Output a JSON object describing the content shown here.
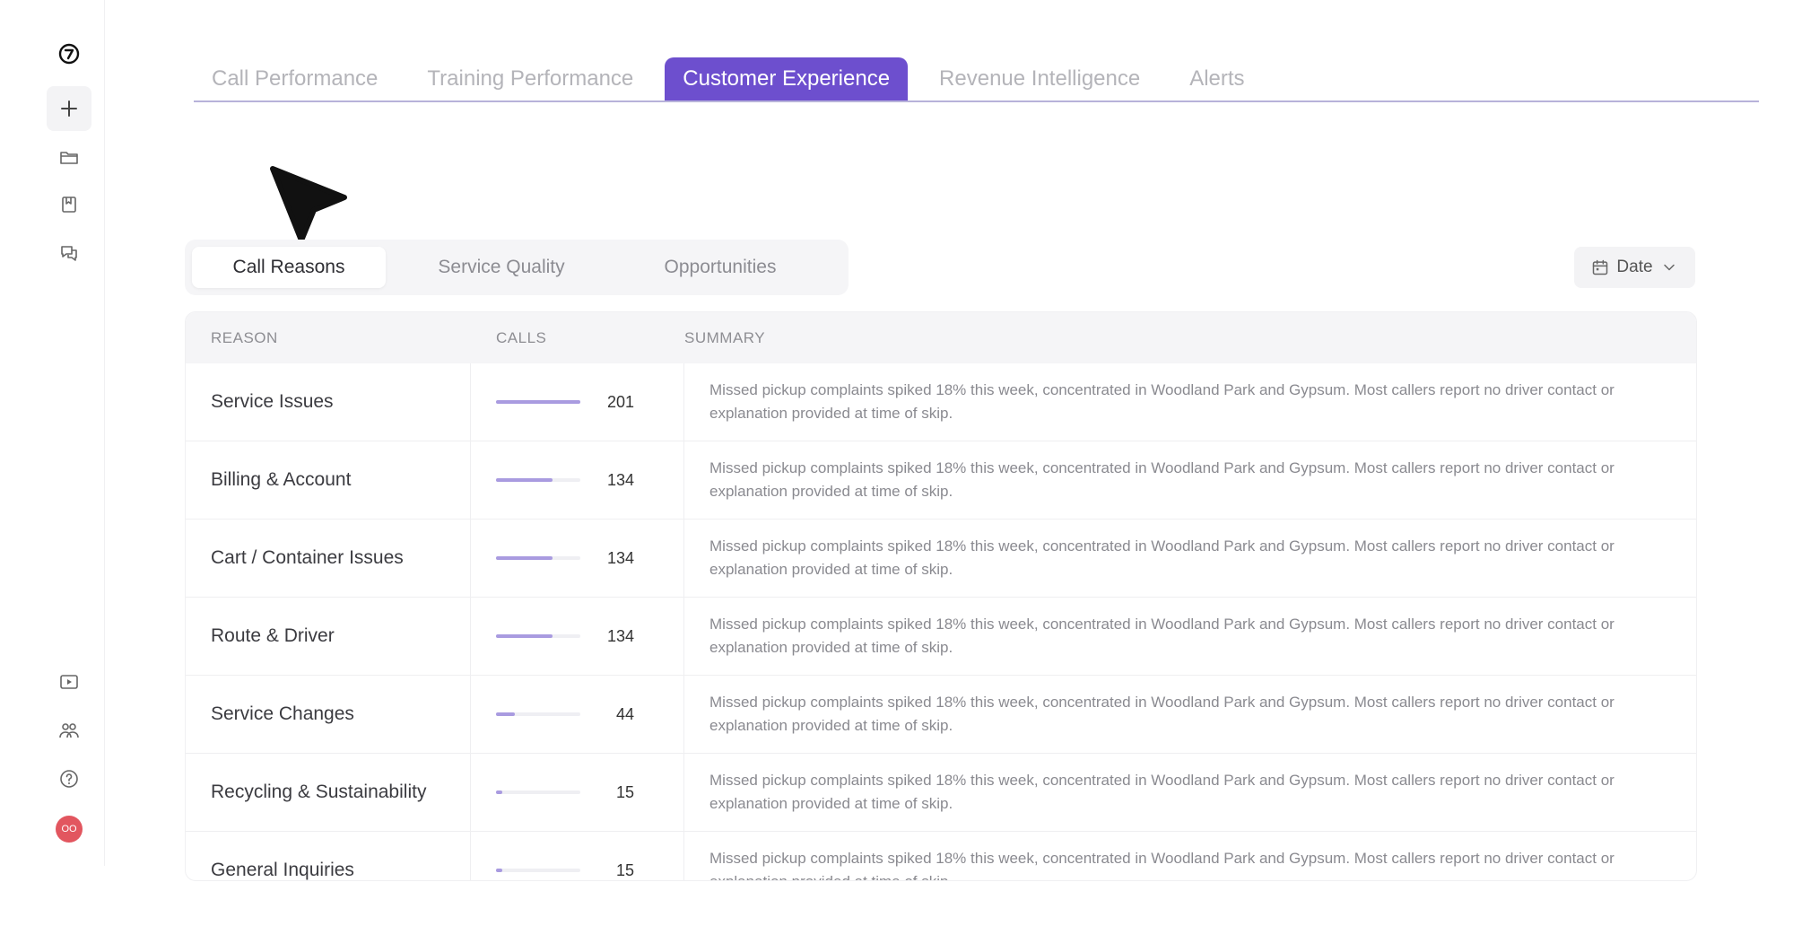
{
  "sidebar": {
    "top_icons": [
      "logo-icon",
      "plus-icon",
      "folder-icon",
      "bookmark-icon",
      "chat-icon"
    ],
    "bottom_icons": [
      "video-icon",
      "team-icon",
      "help-icon"
    ],
    "avatar": "OO"
  },
  "top_tabs": [
    {
      "label": "Call Performance",
      "active": false
    },
    {
      "label": "Training Performance",
      "active": false
    },
    {
      "label": "Customer Experience",
      "active": true
    },
    {
      "label": "Revenue Intelligence",
      "active": false
    },
    {
      "label": "Alerts",
      "active": false
    }
  ],
  "sub_tabs": [
    {
      "label": "Call Reasons",
      "active": true
    },
    {
      "label": "Service Quality",
      "active": false
    },
    {
      "label": "Opportunities",
      "active": false
    }
  ],
  "date_filter": {
    "label": "Date"
  },
  "table": {
    "headers": {
      "reason": "REASON",
      "calls": "CALLS",
      "summary": "SUMMARY"
    },
    "rows": [
      {
        "reason": "Service Issues",
        "calls": "201",
        "fraction": 1.0,
        "summary": "Missed pickup complaints spiked 18% this week, concentrated in Woodland Park and Gypsum. Most callers report no driver contact or explanation provided at time of skip."
      },
      {
        "reason": "Billing & Account",
        "calls": "134",
        "fraction": 0.667,
        "summary": "Missed pickup complaints spiked 18% this week, concentrated in Woodland Park and Gypsum. Most callers report no driver contact or explanation provided at time of skip."
      },
      {
        "reason": "Cart / Container Issues",
        "calls": "134",
        "fraction": 0.667,
        "summary": "Missed pickup complaints spiked 18% this week, concentrated in Woodland Park and Gypsum. Most callers report no driver contact or explanation provided at time of skip."
      },
      {
        "reason": "Route & Driver",
        "calls": "134",
        "fraction": 0.667,
        "summary": "Missed pickup complaints spiked 18% this week, concentrated in Woodland Park and Gypsum. Most callers report no driver contact or explanation provided at time of skip."
      },
      {
        "reason": "Service Changes",
        "calls": "44",
        "fraction": 0.219,
        "summary": "Missed pickup complaints spiked 18% this week, concentrated in Woodland Park and Gypsum. Most callers report no driver contact or explanation provided at time of skip."
      },
      {
        "reason": "Recycling & Sustainability",
        "calls": "15",
        "fraction": 0.075,
        "summary": "Missed pickup complaints spiked 18% this week, concentrated in Woodland Park and Gypsum. Most callers report no driver contact or explanation provided at time of skip."
      },
      {
        "reason": "General Inquiries",
        "calls": "15",
        "fraction": 0.075,
        "summary": "Missed pickup complaints spiked 18% this week, concentrated in Woodland Park and Gypsum. Most callers report no driver contact or explanation provided at time of skip."
      }
    ]
  }
}
